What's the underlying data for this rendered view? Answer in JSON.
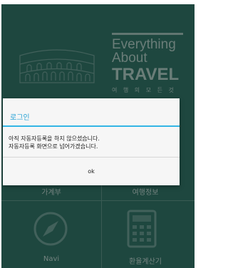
{
  "background": {
    "title_lines": [
      "Everything",
      "About",
      "TRAVEL"
    ],
    "subtitle": "여 행 의 모 든 것",
    "tiles": [
      {
        "label": "가계부",
        "icon": "ledger-icon"
      },
      {
        "label": "여행정보",
        "icon": "travel-info-icon"
      },
      {
        "label": "Navi",
        "icon": "compass-icon"
      },
      {
        "label": "환율계산기",
        "icon": "calculator-icon"
      }
    ]
  },
  "dialog": {
    "title": "로그인",
    "message_lines": [
      "아직 자동자등록을 하지 않으셨습니다.",
      "자동자등록 화면으로 넘어가겠습니다."
    ],
    "ok_label": "ok"
  },
  "colors": {
    "background": "#2f6d62",
    "dialog_accent": "#33b5e5"
  }
}
